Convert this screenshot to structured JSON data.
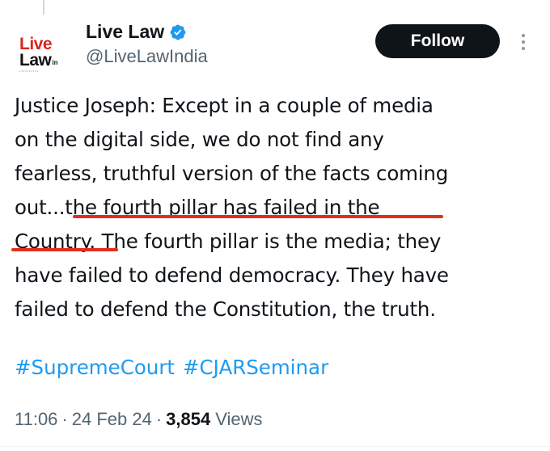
{
  "author": {
    "logo_line1": "Live",
    "logo_line2": "Law",
    "logo_suffix": "in",
    "display_name": "Live Law",
    "handle": "@LiveLawIndia",
    "verified_color": "#1d9bf0"
  },
  "actions": {
    "follow_label": "Follow"
  },
  "tweet": {
    "lines": [
      "Justice Joseph: Except in a couple of media",
      "on the digital side, we do not find any",
      "fearless, truthful version of the facts coming",
      "out...the fourth pillar has failed in the",
      "Country. The fourth pillar is the media; they",
      "have failed to defend democracy. They have",
      "failed to defend the Constitution, the truth."
    ],
    "hashtags": [
      "#SupremeCourt",
      "#CJARSeminar"
    ],
    "time": "11:06",
    "date": "24 Feb 24",
    "views_count": "3,854",
    "views_label": "Views",
    "highlight_color": "#e0301e"
  }
}
